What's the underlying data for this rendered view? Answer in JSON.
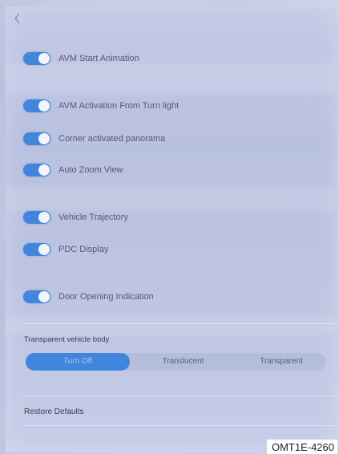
{
  "header": {
    "back_icon": "chevron-left-icon"
  },
  "toggles": [
    {
      "label": "AVM Start Animation",
      "on": true
    },
    {
      "label": "AVM Activation From Turn light",
      "on": true
    },
    {
      "label": "Corner activated panorama",
      "on": true
    },
    {
      "label": "Auto Zoom View",
      "on": true
    },
    {
      "label": "Vehicle Trajectory",
      "on": true
    },
    {
      "label": "PDC Display",
      "on": true
    },
    {
      "label": "Door Opening Indication",
      "on": true
    }
  ],
  "transparent_body": {
    "label": "Transparent vehicle body",
    "options": [
      "Turn Off",
      "Translucent",
      "Transparent"
    ],
    "selected": "Turn Off"
  },
  "restore": {
    "label": "Restore Defaults"
  },
  "caption": "OMT1E-4260",
  "colors": {
    "accent": "#3f86dc",
    "screen_bg": "#bfc6e3",
    "text": "#525a7a"
  }
}
